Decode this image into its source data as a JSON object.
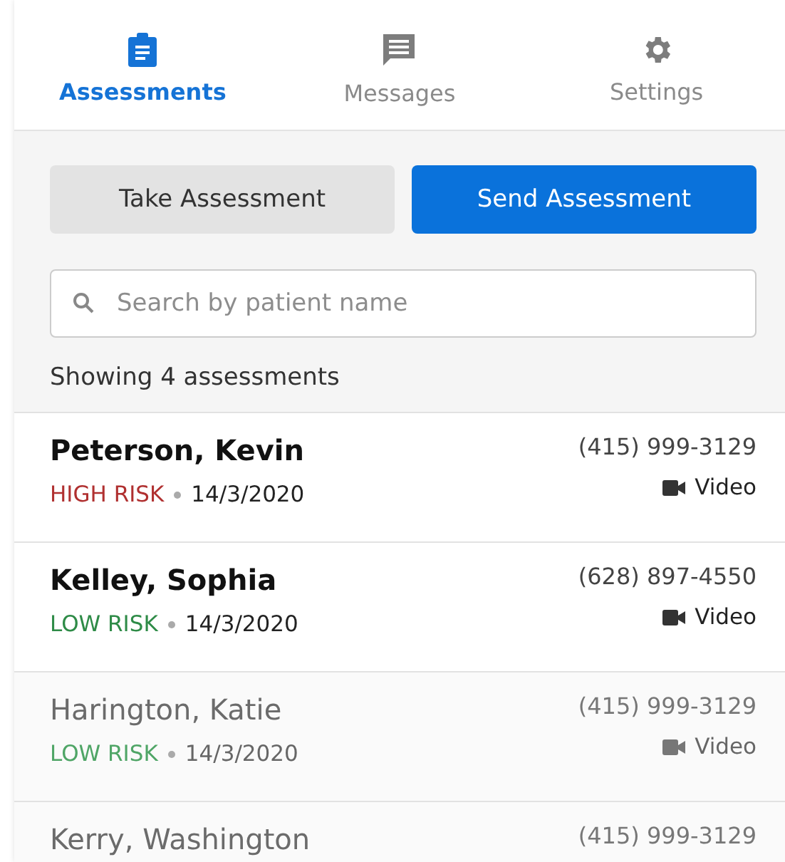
{
  "tabs": [
    {
      "label": "Assessments",
      "kind": "clipboard",
      "selected": true
    },
    {
      "label": "Messages",
      "kind": "message",
      "selected": false
    },
    {
      "label": "Settings",
      "kind": "gear",
      "selected": false
    }
  ],
  "actions": [
    {
      "label": "Take Assessment",
      "kind": "secondary"
    },
    {
      "label": "Send Assessment",
      "kind": "primary"
    }
  ],
  "search": {
    "placeholder": "Search by patient name"
  },
  "summary": "Showing 4 assessments",
  "assessments": [
    {
      "name": "Peterson, Kevin",
      "phone": "(415) 999-3129",
      "risk": "HIGH RISK",
      "kind": "high",
      "date": "14/3/2020",
      "mode": "Video",
      "unread": true
    },
    {
      "name": "Kelley, Sophia",
      "phone": "(628) 897-4550",
      "risk": "LOW RISK",
      "kind": "low",
      "date": "14/3/2020",
      "mode": "Video",
      "unread": true
    },
    {
      "name": "Harington, Katie",
      "phone": "(415) 999-3129",
      "risk": "LOW RISK",
      "kind": "low",
      "date": "14/3/2020",
      "mode": "Video",
      "unread": false
    },
    {
      "name": "Kerry, Washington",
      "phone": "(415) 999-3129",
      "unread": false
    }
  ]
}
